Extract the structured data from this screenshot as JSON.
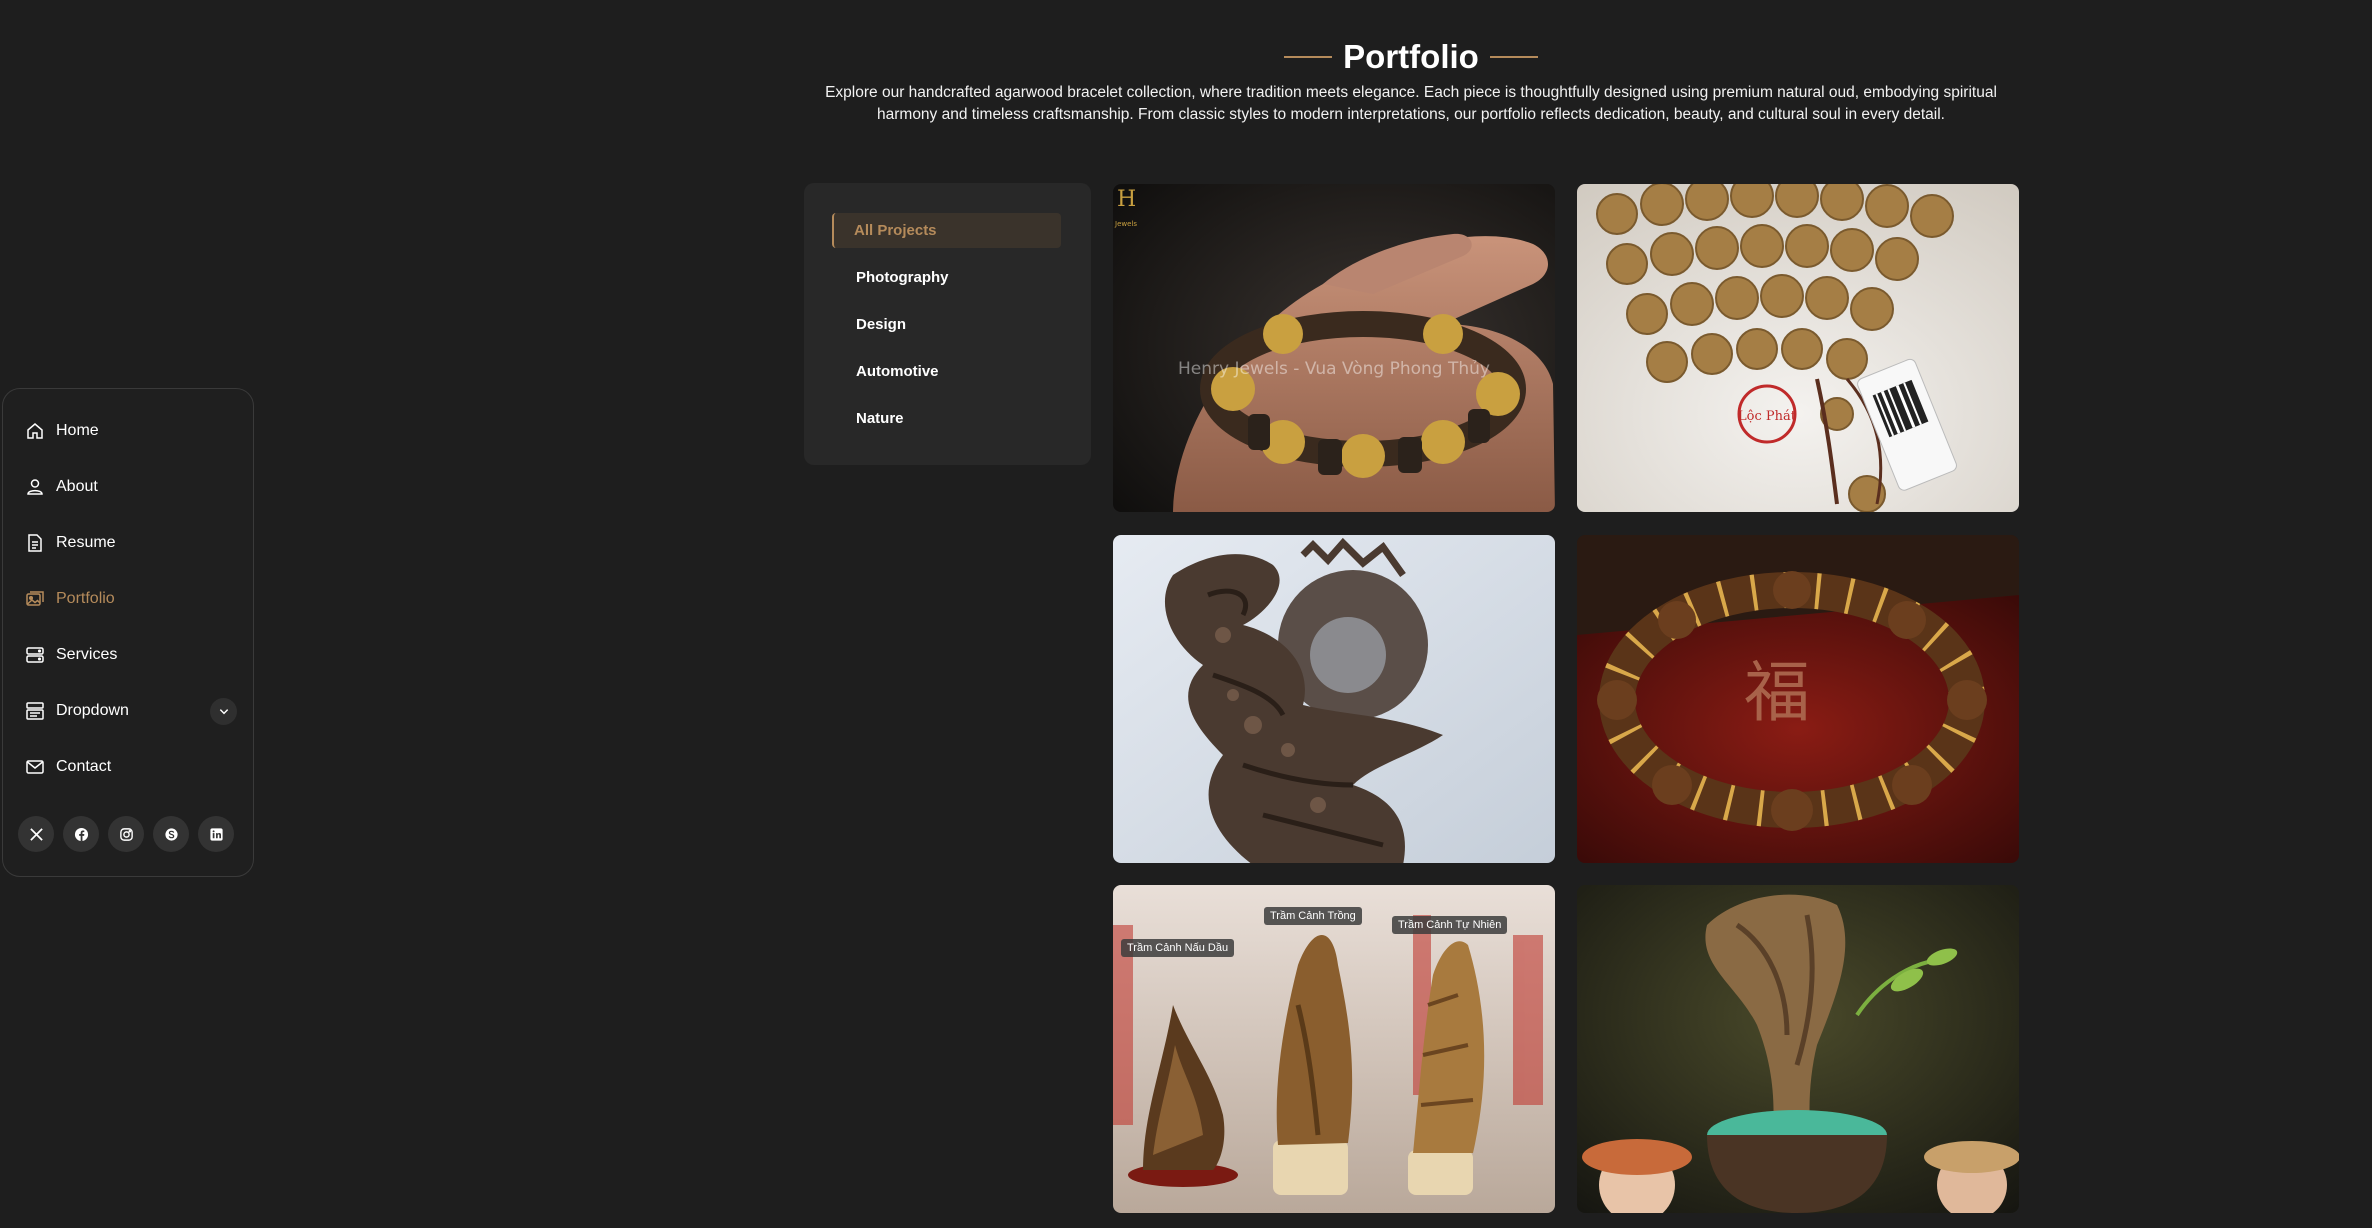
{
  "nav": {
    "items": [
      {
        "label": "Home",
        "icon": "house-icon"
      },
      {
        "label": "About",
        "icon": "person-icon"
      },
      {
        "label": "Resume",
        "icon": "file-text-icon"
      },
      {
        "label": "Portfolio",
        "icon": "images-icon",
        "active": true
      },
      {
        "label": "Services",
        "icon": "hdd-stack-icon"
      },
      {
        "label": "Dropdown",
        "icon": "menu-app-icon",
        "has_chevron": true
      },
      {
        "label": "Contact",
        "icon": "envelope-icon"
      }
    ],
    "socials": [
      "x-twitter-icon",
      "facebook-icon",
      "instagram-icon",
      "skype-icon",
      "linkedin-icon"
    ]
  },
  "header": {
    "title": "Portfolio",
    "intro": "Explore our handcrafted agarwood bracelet collection, where tradition meets elegance. Each piece is thoughtfully designed using premium natural oud, embodying spiritual harmony and timeless craftsmanship. From classic styles to modern interpretations, our portfolio reflects dedication, beauty, and cultural soul in every detail."
  },
  "filters": [
    "All Projects",
    "Photography",
    "Design",
    "Automotive",
    "Nature"
  ],
  "filter_active": "All Projects",
  "gallery": {
    "items": [
      {
        "subject": "hand holding gold-accent agarwood bracelet",
        "overlay_text": "Henry Jewels - Vua Vòng Phong Thủy",
        "corner_text": "Jewels"
      },
      {
        "subject": "agarwood prayer beads with price tag",
        "tag_text": "Lộc Phát"
      },
      {
        "subject": "carved agarwood sculpture"
      },
      {
        "subject": "agarwood bracelet on red box",
        "seal_text": "福"
      },
      {
        "subject": "natural agarwood pieces on stands",
        "labels": [
          "Trầm Cảnh Nấu Dầu",
          "Trầm Cảnh Trồng",
          "Trầm Cảnh Tự Nhiên"
        ]
      },
      {
        "subject": "agarwood in planter with figurines"
      }
    ]
  },
  "colors": {
    "background": "#1e1e1e",
    "accent": "#b58b5b",
    "panel": "#282828",
    "text": "#ffffff"
  }
}
